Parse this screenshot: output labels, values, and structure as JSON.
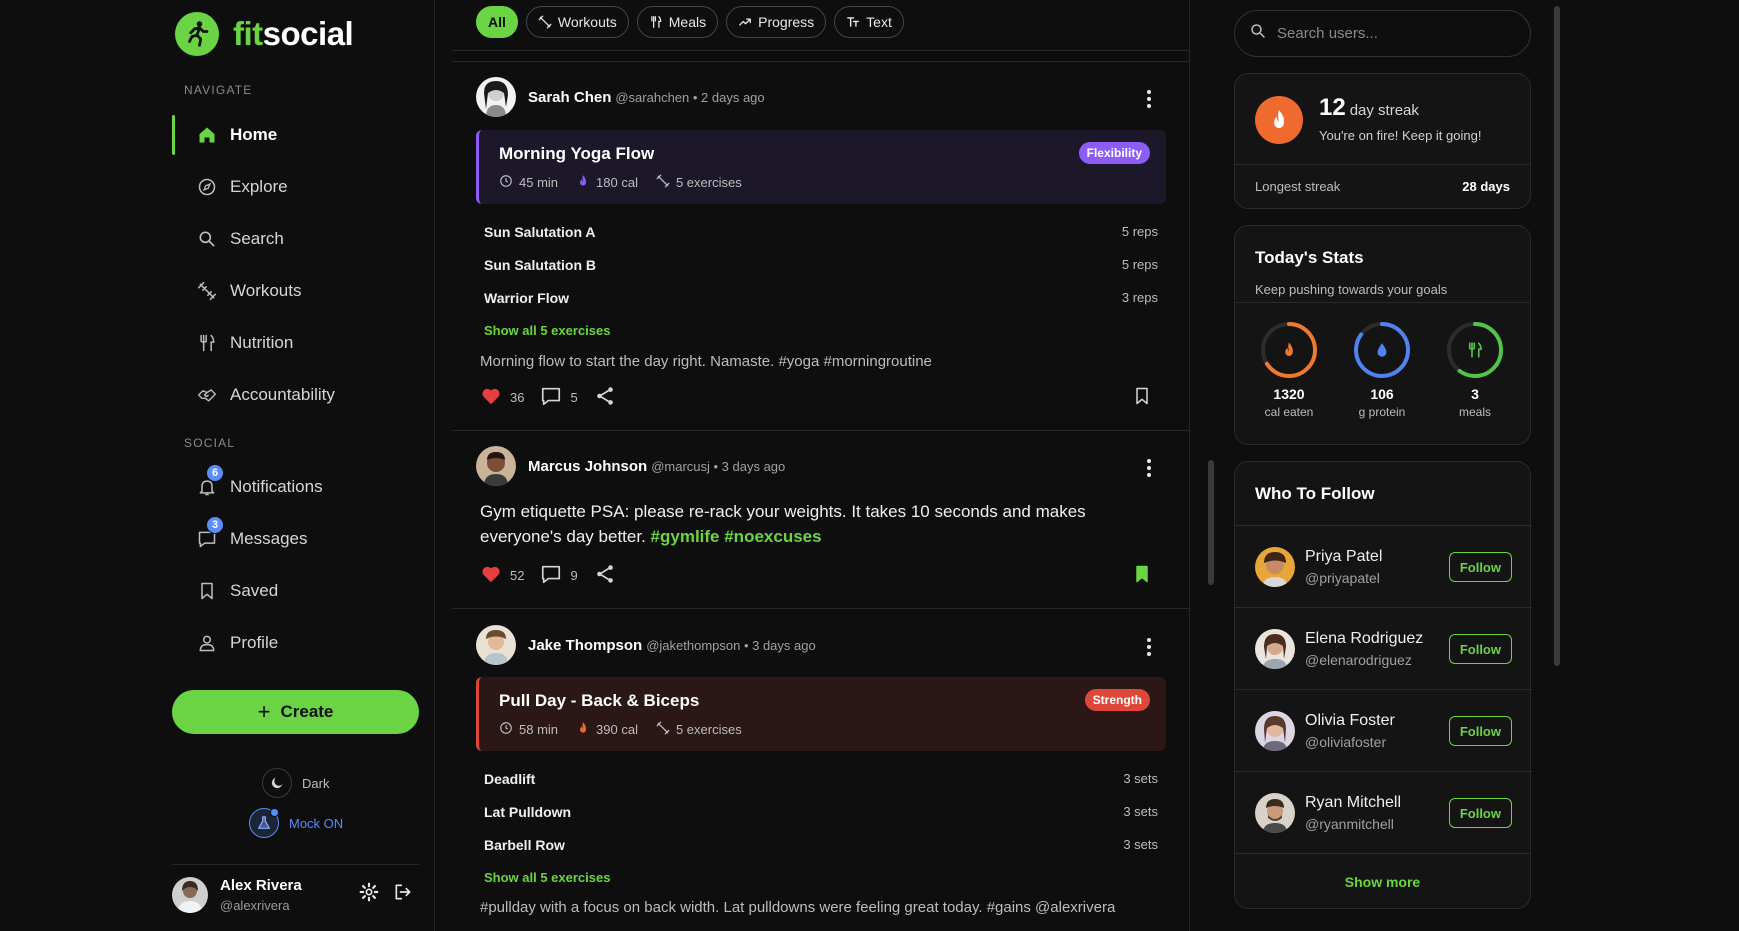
{
  "brand": {
    "fit": "fit",
    "social": "social",
    "accent": "#6ad444"
  },
  "sidebar": {
    "navigate_label": "NAVIGATE",
    "social_label": "SOCIAL",
    "nav": [
      {
        "label": "Home",
        "icon": "home-icon"
      },
      {
        "label": "Explore",
        "icon": "compass-icon"
      },
      {
        "label": "Search",
        "icon": "search-icon"
      },
      {
        "label": "Workouts",
        "icon": "dumbbell-icon"
      },
      {
        "label": "Nutrition",
        "icon": "utensils-icon"
      },
      {
        "label": "Accountability",
        "icon": "handshake-icon"
      }
    ],
    "social": [
      {
        "label": "Notifications",
        "icon": "bell-icon",
        "badge": "6"
      },
      {
        "label": "Messages",
        "icon": "message-icon",
        "badge": "3"
      },
      {
        "label": "Saved",
        "icon": "bookmark-icon"
      },
      {
        "label": "Profile",
        "icon": "user-icon"
      }
    ],
    "create_label": "Create",
    "theme_label": "Dark",
    "mock_label": "Mock ON",
    "mock_color": "#5b8df7",
    "user": {
      "name": "Alex Rivera",
      "handle": "@alexrivera"
    }
  },
  "feed": {
    "filters": [
      "All",
      "Workouts",
      "Meals",
      "Progress",
      "Text"
    ],
    "posts": [
      {
        "name": "Sarah Chen",
        "meta": "@sarahchen • 2 days ago",
        "workout": {
          "title": "Morning Yoga Flow",
          "tag": "Flexibility",
          "tag_color": "#8b5cf6",
          "card_bg": "#1d1829",
          "bar_color": "#8b5cf6",
          "flame_color": "#8b5cf6",
          "duration": "45 min",
          "calories": "180 cal",
          "exercises": "5 exercises"
        },
        "exercises": [
          {
            "name": "Sun Salutation A",
            "qty": "5 reps"
          },
          {
            "name": "Sun Salutation B",
            "qty": "5 reps"
          },
          {
            "name": "Warrior Flow",
            "qty": "3 reps"
          }
        ],
        "show_all": "Show all 5 exercises",
        "caption": "Morning flow to start the day right. Namaste. #yoga #morningroutine",
        "likes": "36",
        "comments": "5"
      },
      {
        "name": "Marcus Johnson",
        "meta": "@marcusj • 3 days ago",
        "body": "Gym etiquette PSA: please re-rack your weights. It takes 10 seconds and makes everyone's day better.",
        "hashtags": "#gymlife #noexcuses",
        "likes": "52",
        "comments": "9"
      },
      {
        "name": "Jake Thompson",
        "meta": "@jakethompson • 3 days ago",
        "workout": {
          "title": "Pull Day - Back & Biceps",
          "tag": "Strength",
          "tag_color": "#e0473b",
          "card_bg": "#2a1716",
          "bar_color": "#e0473b",
          "flame_color": "#ef6a2e",
          "duration": "58 min",
          "calories": "390 cal",
          "exercises": "5 exercises"
        },
        "exercises": [
          {
            "name": "Deadlift",
            "qty": "3 sets"
          },
          {
            "name": "Lat Pulldown",
            "qty": "3 sets"
          },
          {
            "name": "Barbell Row",
            "qty": "3 sets"
          }
        ],
        "show_all": "Show all 5 exercises",
        "caption": "#pullday with a focus on back width. Lat pulldowns were feeling great today. #gains @alexrivera"
      }
    ]
  },
  "right": {
    "search_placeholder": "Search users...",
    "streak": {
      "value": "12",
      "unit": "day streak",
      "sub": "You're on fire! Keep it going!",
      "longest_label": "Longest streak",
      "longest_value": "28 days"
    },
    "stats": {
      "title": "Today's Stats",
      "sub": "Keep pushing towards your goals",
      "items": [
        {
          "value": "1320",
          "label": "cal eaten",
          "color": "#ef7a2e",
          "icon": "flame-icon",
          "progress": 0.66
        },
        {
          "value": "106",
          "label": "g protein",
          "color": "#4f83f1",
          "icon": "droplet-icon",
          "progress": 0.85
        },
        {
          "value": "3",
          "label": "meals",
          "color": "#52c447",
          "icon": "utensils-icon",
          "progress": 0.6
        }
      ]
    },
    "who_to_follow": {
      "title": "Who To Follow",
      "follow_label": "Follow",
      "users": [
        {
          "name": "Priya Patel",
          "handle": "@priyapatel"
        },
        {
          "name": "Elena Rodriguez",
          "handle": "@elenarodriguez"
        },
        {
          "name": "Olivia Foster",
          "handle": "@oliviafoster"
        },
        {
          "name": "Ryan Mitchell",
          "handle": "@ryanmitchell"
        }
      ],
      "show_more": "Show more"
    }
  }
}
